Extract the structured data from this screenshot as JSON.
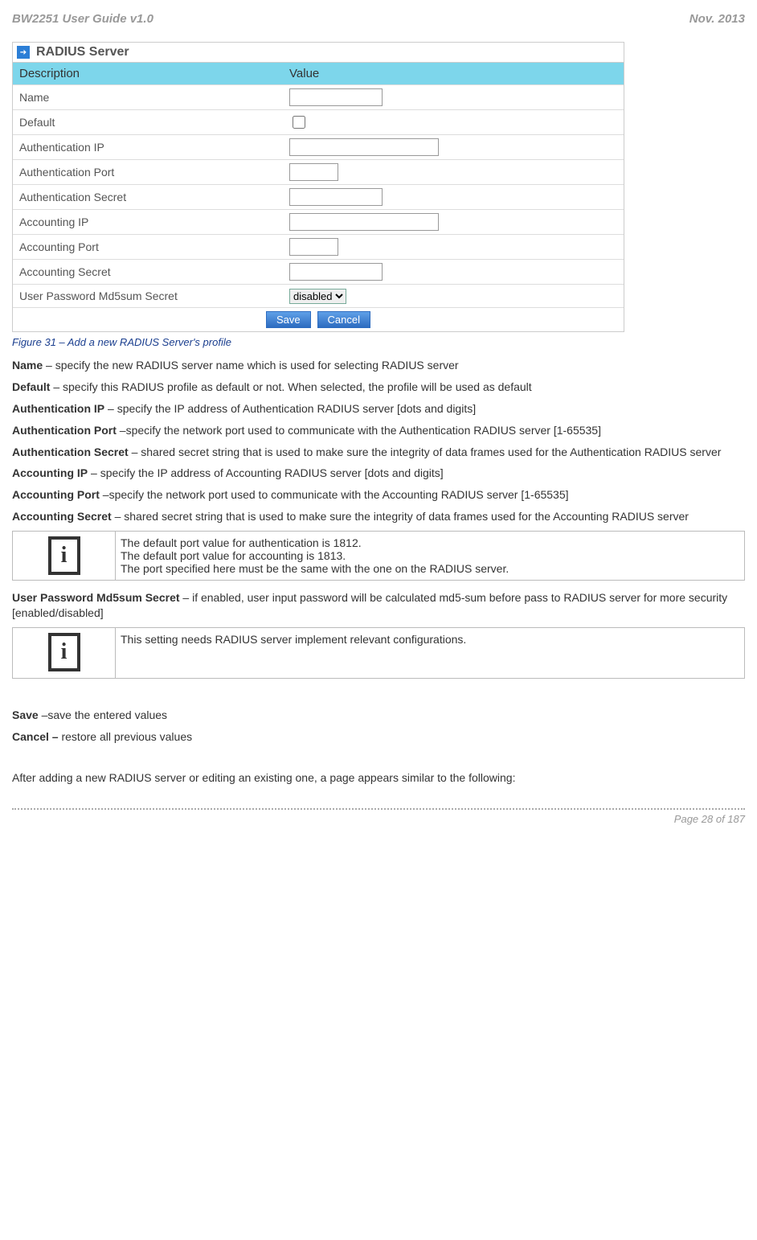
{
  "header": {
    "left": "BW2251 User Guide v1.0",
    "right": "Nov.  2013"
  },
  "form": {
    "title": "RADIUS Server",
    "header_desc": "Description",
    "header_val": "Value",
    "rows": {
      "name": "Name",
      "default": "Default",
      "auth_ip": "Authentication IP",
      "auth_port": "Authentication Port",
      "auth_secret": "Authentication Secret",
      "acct_ip": "Accounting IP",
      "acct_port": "Accounting Port",
      "acct_secret": "Accounting Secret",
      "md5": "User Password Md5sum Secret"
    },
    "md5_select": "disabled",
    "save": "Save",
    "cancel": "Cancel"
  },
  "caption": "Figure 31 – Add a new RADIUS Server's profile",
  "paragraphs": {
    "p1_b": "Name",
    "p1": " – specify the new RADIUS server name which is used for selecting RADIUS server",
    "p2_b": "Default",
    "p2": " – specify this RADIUS profile as default or not. When selected, the profile will be used as default",
    "p3_b": "Authentication IP",
    "p3": " – specify the IP address of Authentication RADIUS server [dots and digits]",
    "p4_b": "Authentication Port",
    "p4": " –specify the network port used to communicate with the Authentication RADIUS server [1-65535]",
    "p5_b": "Authentication Secret",
    "p5": " – shared secret string that is used to make sure the integrity of data frames used for the Authentication RADIUS server",
    "p6_b": "Accounting IP",
    "p6": " – specify the IP address of Accounting RADIUS server [dots and digits]",
    "p7_b": "Accounting Port",
    "p7": " –specify the network port used to communicate with the Accounting RADIUS server [1-65535]",
    "p8_b": "Accounting Secret",
    "p8": " – shared secret string that is used to make sure the integrity of data frames used for the Accounting RADIUS server"
  },
  "info1": {
    "line1": "The default port value for authentication is 1812.",
    "line2": "The default port value for accounting is 1813.",
    "line3": "The port specified here must be the same with the one on the RADIUS server."
  },
  "p9_b": "User Password Md5sum Secret",
  "p9": " – if enabled, user input password will be calculated md5-sum before pass to RADIUS server for more security [enabled/disabled]",
  "info2": "This setting needs RADIUS server implement relevant configurations.",
  "p10_b": "Save",
  "p10": " –save the entered values",
  "p11_b": "Cancel –",
  "p11": " restore all previous values",
  "p12": "After adding a new RADIUS server or editing an existing one, a page appears similar to the following:",
  "footer": "Page 28 of 187"
}
